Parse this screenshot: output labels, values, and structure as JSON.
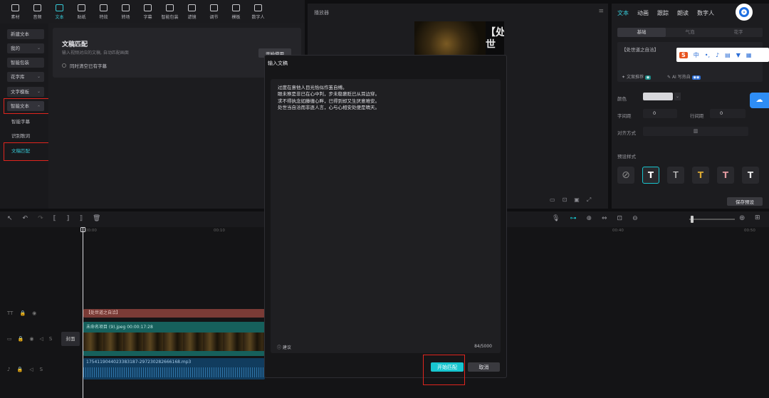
{
  "toolbar": {
    "tools": [
      {
        "label": "素材"
      },
      {
        "label": "音频"
      },
      {
        "label": "文本"
      },
      {
        "label": "贴纸"
      },
      {
        "label": "特效"
      },
      {
        "label": "转场"
      },
      {
        "label": "字幕"
      },
      {
        "label": "智能包装"
      },
      {
        "label": "滤镜"
      },
      {
        "label": "调节"
      },
      {
        "label": "模板"
      },
      {
        "label": "数字人"
      }
    ]
  },
  "left_menu": {
    "new_text": "新建文本",
    "mine": "我的",
    "smart_pack": "智能包装",
    "fancy": "花字库",
    "template": "文字模板",
    "smart_text": "智能文本",
    "smart_caption": "智能字幕",
    "lyrics": "识别歌词",
    "script_match": "文稿匹配"
  },
  "match_panel": {
    "title": "文稿匹配",
    "desc": "输入视频对应的文稿, 自动匹配画面",
    "start": "开始使用",
    "checkbox": "同时清空已有字幕"
  },
  "player": {
    "title": "播放器",
    "poster": "【处世"
  },
  "right_panel": {
    "tabs": [
      "文本",
      "动画",
      "跟踪",
      "朗读",
      "数字人"
    ],
    "subtabs": [
      "基础",
      "气泡",
      "花字"
    ],
    "text_value": "【处世道之自洽】",
    "ai_recommend": "文案推荐",
    "ai_write": "AI 写热自",
    "color": "颜色",
    "char_spacing": "字间距",
    "char_spacing_val": "0",
    "line_spacing": "行间距",
    "line_spacing_val": "0",
    "align": "对齐方式",
    "preset": "预设样式",
    "save_preset": "保存预设"
  },
  "ime": {
    "zh": "中",
    "dot": "•,"
  },
  "timeline": {
    "ticks": [
      "00:00",
      "00:10",
      "00:40",
      "00:50"
    ],
    "text_clip": "【处世道之自洽】",
    "video_clip": "未命名项目 (9).jpeg  00:00:17:28",
    "cover": "封面",
    "audio_clip": "1754119044023383187-297230282666168.mp3"
  },
  "modal": {
    "title": "输入文稿",
    "lines": [
      "过度在意他人目光恰似作茧自缚。",
      "眼未察是非已在心中判，步未稳褒贬已从耳边穿。",
      "求不得执念如藤缠心畔，已得到却又生厌意难安。",
      "处世当自洽而非逐人言，心与心相安处便是晴天。"
    ],
    "suggest": "建议",
    "count": "84/5000",
    "start": "开始匹配",
    "cancel": "取消"
  },
  "colors": {
    "accent": "#18c5cf",
    "highlight": "#e0251e"
  }
}
